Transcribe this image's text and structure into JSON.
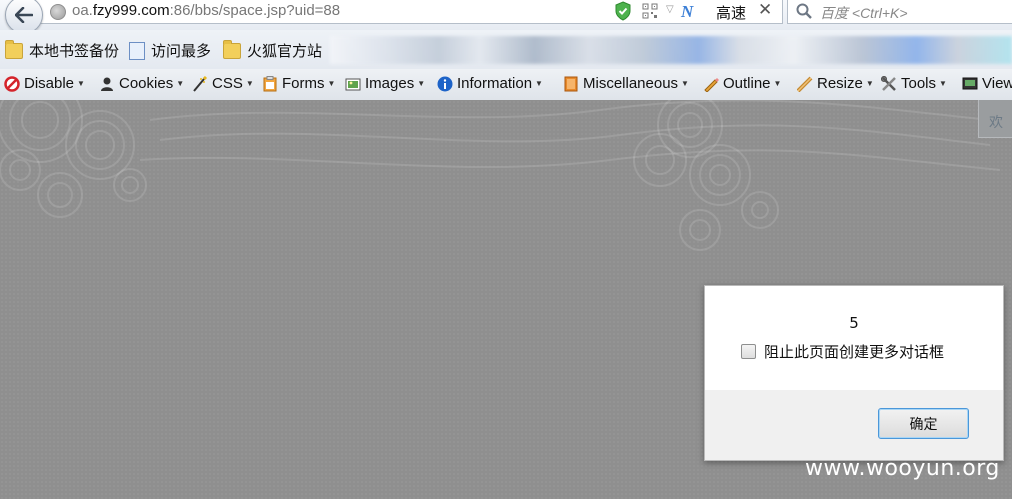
{
  "urlbar": {
    "host_prefix": "oa.",
    "host_main": "fzy999.com",
    "url_rest": ":86/bbs/space.jsp?uid=88",
    "speed_label": "高速",
    "close_glyph": "✕"
  },
  "search": {
    "placeholder": "百度 <Ctrl+K>"
  },
  "bookmarks": [
    {
      "label": "本地书签备份",
      "icon": "folder-icon"
    },
    {
      "label": "访问最多",
      "icon": "page-icon"
    },
    {
      "label": "火狐官方站",
      "icon": "folder-icon"
    }
  ],
  "devtoolbar": {
    "items": [
      {
        "label": "Disable",
        "icon": "disable-icon"
      },
      {
        "label": "Cookies",
        "icon": "cookies-icon"
      },
      {
        "label": "CSS",
        "icon": "css-icon"
      },
      {
        "label": "Forms",
        "icon": "forms-icon"
      },
      {
        "label": "Images",
        "icon": "images-icon"
      },
      {
        "label": "Information",
        "icon": "information-icon"
      },
      {
        "label": "Miscellaneous",
        "icon": "miscellaneous-icon"
      },
      {
        "label": "Outline",
        "icon": "outline-icon"
      },
      {
        "label": "Resize",
        "icon": "resize-icon"
      },
      {
        "label": "Tools",
        "icon": "tools-icon"
      },
      {
        "label": "View",
        "icon": "view-icon"
      }
    ]
  },
  "page": {
    "welcome_tab": "欢"
  },
  "dialog": {
    "message": "5",
    "checkbox_label": "阻止此页面创建更多对话框",
    "ok_label": "确定"
  },
  "watermark": "www.wooyun.org"
}
